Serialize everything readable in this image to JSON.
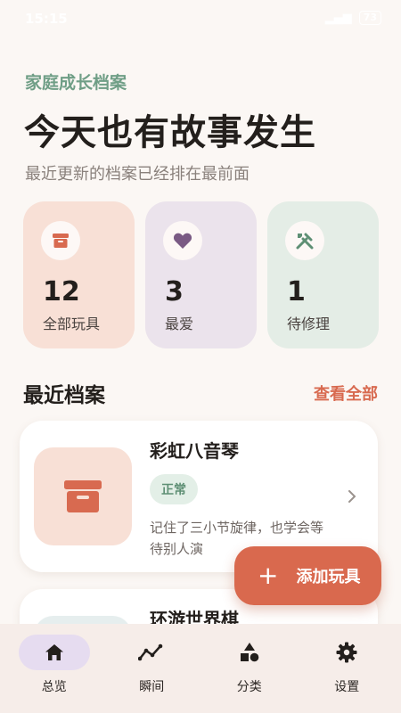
{
  "status_bar": {
    "time": "15:15",
    "battery": "73"
  },
  "header": {
    "eyebrow": "家庭成长档案",
    "title": "今天也有故事发生",
    "subtitle": "最近更新的档案已经排在最前面"
  },
  "stats": [
    {
      "value": "12",
      "label": "全部玩具",
      "icon": "archive-box-icon",
      "color": "#d86a50"
    },
    {
      "value": "3",
      "label": "最爱",
      "icon": "heart-icon",
      "color": "#7a5a84"
    },
    {
      "value": "1",
      "label": "待修理",
      "icon": "tools-icon",
      "color": "#5e8f74"
    }
  ],
  "recent": {
    "title": "最近档案",
    "see_all": "查看全部",
    "items": [
      {
        "title": "彩虹八音琴",
        "status": "正常",
        "description": "记住了三小节旋律，也学会等待别人演",
        "icon": "archive-box-icon"
      },
      {
        "title": "环游世界棋",
        "icon": "board-game-icon"
      }
    ]
  },
  "fab": {
    "label": "添加玩具",
    "icon": "plus-icon"
  },
  "nav": [
    {
      "label": "总览",
      "icon": "home-icon",
      "active": true
    },
    {
      "label": "瞬间",
      "icon": "trend-line-icon",
      "active": false
    },
    {
      "label": "分类",
      "icon": "shapes-icon",
      "active": false
    },
    {
      "label": "设置",
      "icon": "gear-icon",
      "active": false
    }
  ],
  "colors": {
    "accent": "#d9694e",
    "green": "#6f9e86",
    "nav_active": "#e6dcf0"
  }
}
